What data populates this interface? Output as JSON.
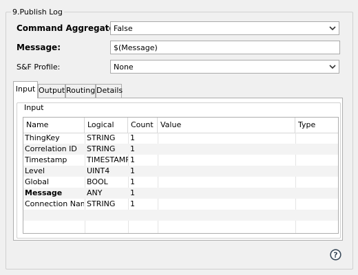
{
  "group_title": "9.Publish Log",
  "form": {
    "aggregator_label": "Command Aggregator:",
    "aggregator_value": "False",
    "message_label": "Message:",
    "message_value": "$(Message)",
    "sf_label": "S&F Profile:",
    "sf_value": "None"
  },
  "tabs": [
    {
      "label": "Input",
      "active": true
    },
    {
      "label": "Output",
      "active": false
    },
    {
      "label": "Routing",
      "active": false
    },
    {
      "label": "Details",
      "active": false
    }
  ],
  "input_group_title": "Input",
  "table": {
    "columns": [
      "Name",
      "Logical",
      "Count",
      "Value",
      "Type"
    ],
    "rows": [
      {
        "name": "ThingKey",
        "logical": "STRING",
        "count": "1",
        "value": "",
        "type": "",
        "bold": false
      },
      {
        "name": "Correlation ID",
        "logical": "STRING",
        "count": "1",
        "value": "",
        "type": "",
        "bold": false
      },
      {
        "name": "Timestamp",
        "logical": "TIMESTAMP",
        "count": "1",
        "value": "",
        "type": "",
        "bold": false
      },
      {
        "name": "Level",
        "logical": "UINT4",
        "count": "1",
        "value": "",
        "type": "",
        "bold": false
      },
      {
        "name": "Global",
        "logical": "BOOL",
        "count": "1",
        "value": "",
        "type": "",
        "bold": false
      },
      {
        "name": "Message",
        "logical": "ANY",
        "count": "1",
        "value": "",
        "type": "",
        "bold": true
      },
      {
        "name": "Connection Name",
        "logical": "STRING",
        "count": "1",
        "value": "",
        "type": "",
        "bold": false
      }
    ]
  },
  "icons": {
    "dropdown": "chevron-down-icon",
    "help": "help-icon"
  }
}
